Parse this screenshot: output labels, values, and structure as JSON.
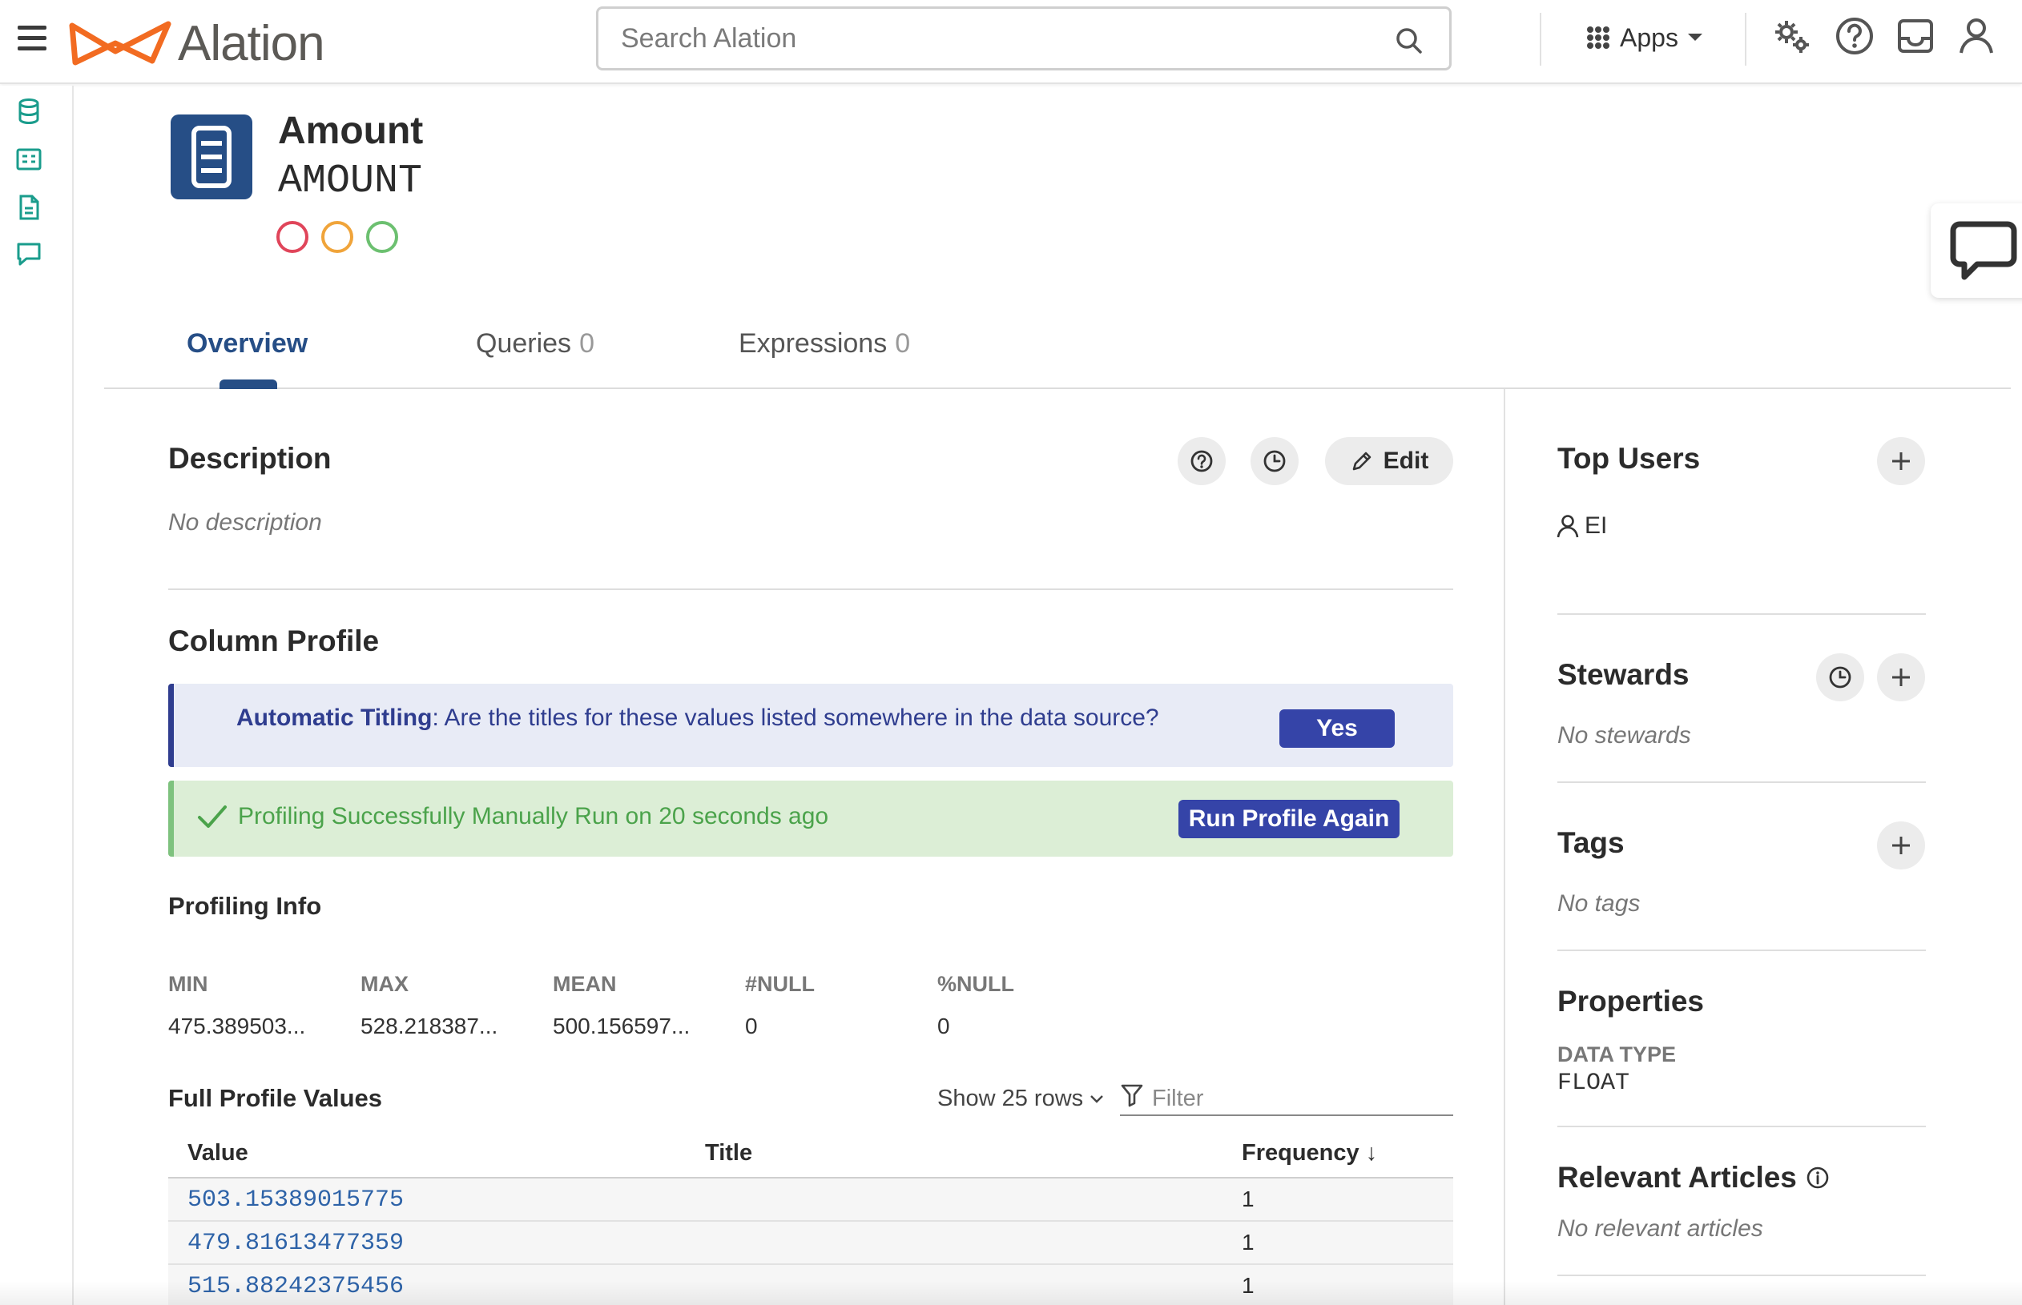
{
  "header": {
    "logo_text": "Alation",
    "search_placeholder": "Search Alation",
    "apps_label": "Apps"
  },
  "object": {
    "title": "Amount",
    "name": "AMOUNT",
    "trust_colors": [
      "#e0455a",
      "#f0a43a",
      "#6cc070"
    ]
  },
  "tabs": [
    {
      "label": "Overview",
      "count": ""
    },
    {
      "label": "Queries",
      "count": "0"
    },
    {
      "label": "Expressions",
      "count": "0"
    }
  ],
  "description": {
    "heading": "Description",
    "empty_text": "No description",
    "edit_label": "Edit"
  },
  "column_profile": {
    "heading": "Column Profile",
    "auto_titling_label": "Automatic Titling",
    "auto_titling_question": ": Are the titles for these values listed somewhere in the data source?",
    "yes_label": "Yes",
    "status_text": "Profiling Successfully Manually Run on 20 seconds ago",
    "run_again_label": "Run Profile Again"
  },
  "profiling_info": {
    "heading": "Profiling Info",
    "stats": [
      {
        "label": "MIN",
        "value": "475.389503..."
      },
      {
        "label": "MAX",
        "value": "528.218387..."
      },
      {
        "label": "MEAN",
        "value": "500.156597..."
      },
      {
        "label": "#NULL",
        "value": "0"
      },
      {
        "label": "%NULL",
        "value": "0"
      }
    ]
  },
  "full_profile": {
    "heading": "Full Profile Values",
    "show_rows_label": "Show 25 rows",
    "filter_placeholder": "Filter",
    "columns": [
      "Value",
      "Title",
      "Frequency ↓"
    ],
    "rows": [
      {
        "value": "503.15389015775",
        "title": "",
        "frequency": "1"
      },
      {
        "value": "479.81613477359",
        "title": "",
        "frequency": "1"
      },
      {
        "value": "515.88242375456",
        "title": "",
        "frequency": "1"
      }
    ]
  },
  "sidebar": {
    "top_users": {
      "heading": "Top Users",
      "users": [
        "EI"
      ]
    },
    "stewards": {
      "heading": "Stewards",
      "empty_text": "No stewards"
    },
    "tags": {
      "heading": "Tags",
      "empty_text": "No tags"
    },
    "properties": {
      "heading": "Properties",
      "data_type_label": "DATA TYPE",
      "data_type_value": "FLOAT"
    },
    "relevant_articles": {
      "heading": "Relevant Articles",
      "empty_text": "No relevant articles"
    }
  },
  "colors": {
    "accent": "#264e86",
    "teal_icons": "#1a9c8c",
    "primary_button": "#3544a8",
    "success": "#4ba34b",
    "logo_orange": "#f26b21"
  }
}
